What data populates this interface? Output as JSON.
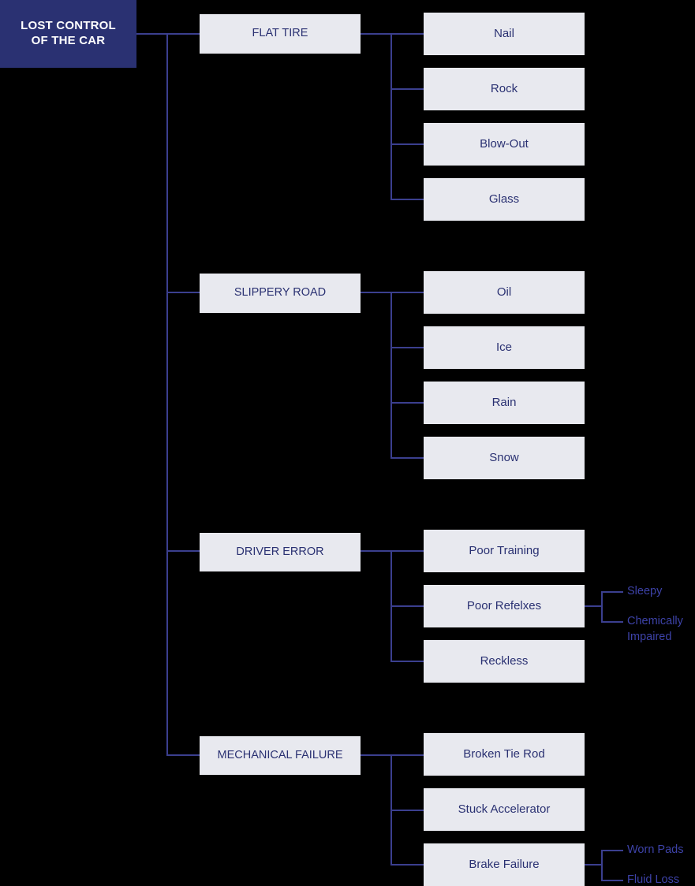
{
  "diagram": {
    "title": "Lost Control of the Car Fault Tree",
    "colors": {
      "background": "#000000",
      "root_fill": "#2a3172",
      "root_text": "#ffffff",
      "box_fill": "#e8e9ef",
      "box_text": "#2a3172",
      "line": "#3b3f8f",
      "leaf_text": "#3d42a8"
    },
    "root": {
      "label": "LOST CONTROL\nOF THE CAR",
      "line1": "LOST CONTROL",
      "line2": "OF THE CAR"
    },
    "branches": [
      {
        "label": "FLAT TIRE",
        "children": [
          {
            "label": "Nail",
            "children": []
          },
          {
            "label": "Rock",
            "children": []
          },
          {
            "label": "Blow-Out",
            "children": []
          },
          {
            "label": "Glass",
            "children": []
          }
        ]
      },
      {
        "label": "SLIPPERY ROAD",
        "children": [
          {
            "label": "Oil",
            "children": []
          },
          {
            "label": "Ice",
            "children": []
          },
          {
            "label": "Rain",
            "children": []
          },
          {
            "label": "Snow",
            "children": []
          }
        ]
      },
      {
        "label": "DRIVER ERROR",
        "children": [
          {
            "label": "Poor Training",
            "children": []
          },
          {
            "label": "Poor Refelxes",
            "children": [
              {
                "label": "Sleepy"
              },
              {
                "label": "Chemically Impaired"
              }
            ]
          },
          {
            "label": "Reckless",
            "children": []
          }
        ]
      },
      {
        "label": "MECHANICAL FAILURE",
        "children": [
          {
            "label": "Broken Tie Rod",
            "children": []
          },
          {
            "label": "Stuck Accelerator",
            "children": []
          },
          {
            "label": "Brake Failure",
            "children": [
              {
                "label": "Worn Pads"
              },
              {
                "label": "Fluid Loss"
              }
            ]
          }
        ]
      }
    ]
  }
}
